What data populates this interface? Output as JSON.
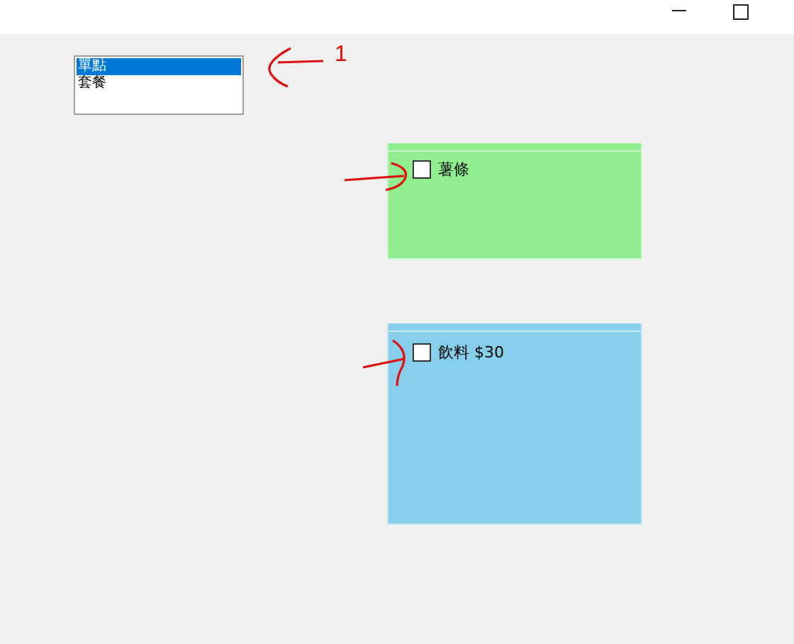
{
  "listbox": {
    "items": [
      {
        "label": "單點",
        "selected": true
      },
      {
        "label": "套餐",
        "selected": false
      }
    ]
  },
  "panels": [
    {
      "color": "#90ee90",
      "checkbox": {
        "label": "薯條",
        "checked": false
      }
    },
    {
      "color": "#87ceeb",
      "checkbox": {
        "label": "飲料 $30",
        "checked": false
      }
    }
  ],
  "annotation": {
    "label": "1"
  }
}
